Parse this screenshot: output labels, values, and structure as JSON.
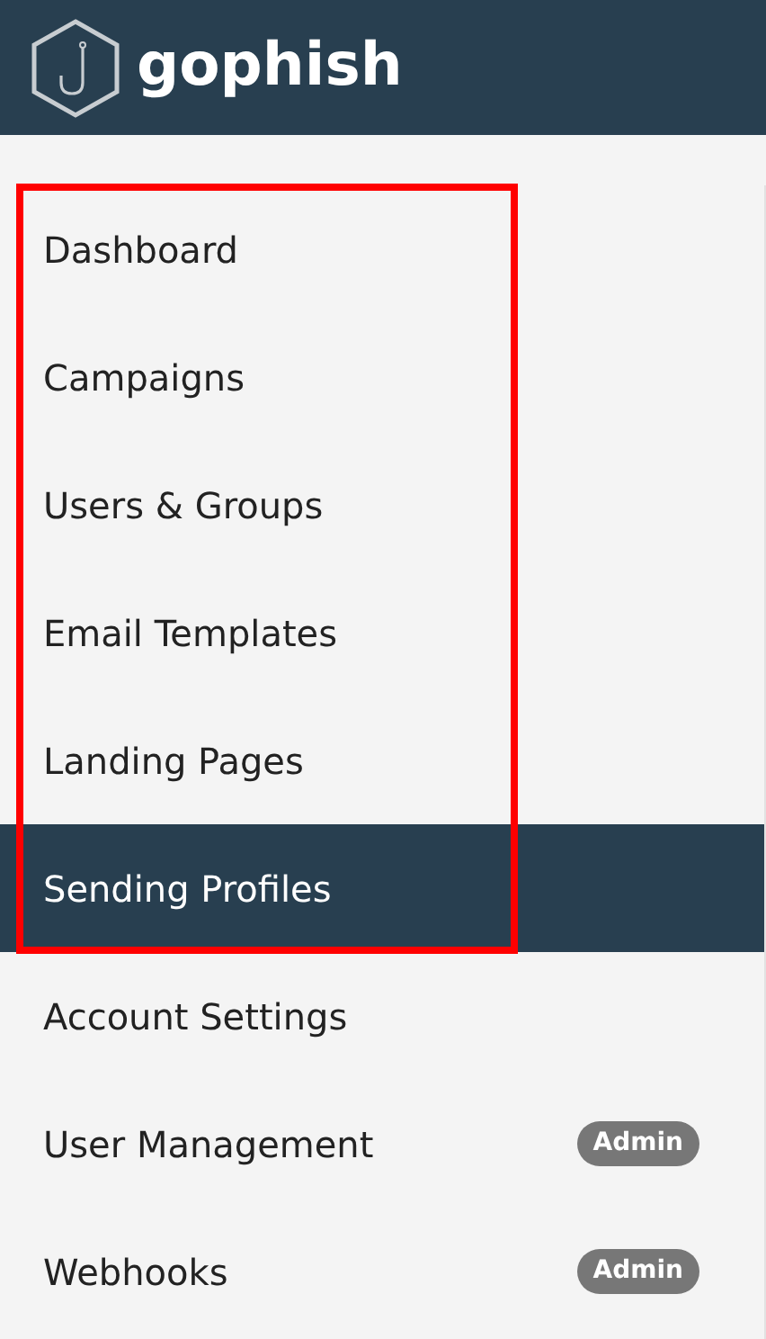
{
  "header": {
    "brand": "gophish"
  },
  "sidebar": {
    "items": [
      {
        "label": "Dashboard",
        "selected": false
      },
      {
        "label": "Campaigns",
        "selected": false
      },
      {
        "label": "Users & Groups",
        "selected": false
      },
      {
        "label": "Email Templates",
        "selected": false
      },
      {
        "label": "Landing Pages",
        "selected": false
      },
      {
        "label": "Sending Profiles",
        "selected": true
      },
      {
        "label": "Account Settings",
        "selected": false
      },
      {
        "label": "User Management",
        "selected": false,
        "badge": "Admin"
      },
      {
        "label": "Webhooks",
        "selected": false,
        "badge": "Admin"
      }
    ]
  }
}
